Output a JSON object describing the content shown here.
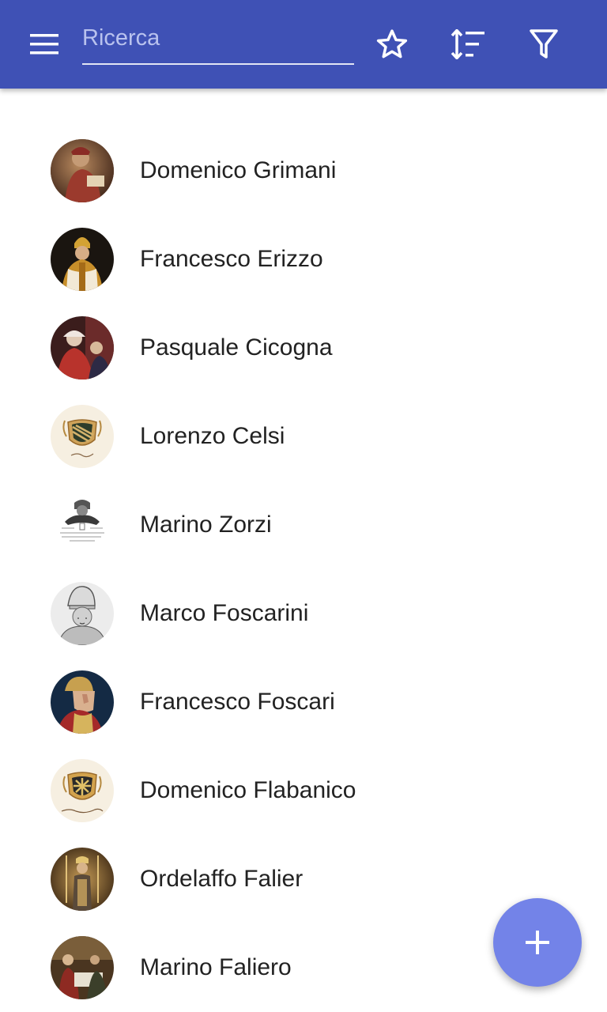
{
  "appbar": {
    "color": "#3f51b5",
    "menu_icon": "hamburger-menu-icon",
    "search": {
      "placeholder": "Ricerca",
      "value": ""
    },
    "actions": [
      {
        "name": "favorites",
        "icon": "star-outline-icon"
      },
      {
        "name": "sort",
        "icon": "sort-icon"
      },
      {
        "name": "filter",
        "icon": "filter-icon"
      }
    ]
  },
  "list": {
    "items": [
      {
        "label": "Domenico Grimani",
        "avatar": "portrait-painting"
      },
      {
        "label": "Francesco Erizzo",
        "avatar": "portrait-painting"
      },
      {
        "label": "Pasquale Cicogna",
        "avatar": "portrait-painting"
      },
      {
        "label": "Lorenzo Celsi",
        "avatar": "coat-of-arms"
      },
      {
        "label": "Marino Zorzi",
        "avatar": "engraving"
      },
      {
        "label": "Marco Foscarini",
        "avatar": "engraving-portrait"
      },
      {
        "label": "Francesco Foscari",
        "avatar": "portrait-painting"
      },
      {
        "label": "Domenico Flabanico",
        "avatar": "coat-of-arms"
      },
      {
        "label": "Ordelaffo Falier",
        "avatar": "mosaic-portrait"
      },
      {
        "label": "Marino Faliero",
        "avatar": "painting-scene"
      }
    ]
  },
  "fab": {
    "icon": "plus-icon",
    "color": "#7383e8"
  }
}
